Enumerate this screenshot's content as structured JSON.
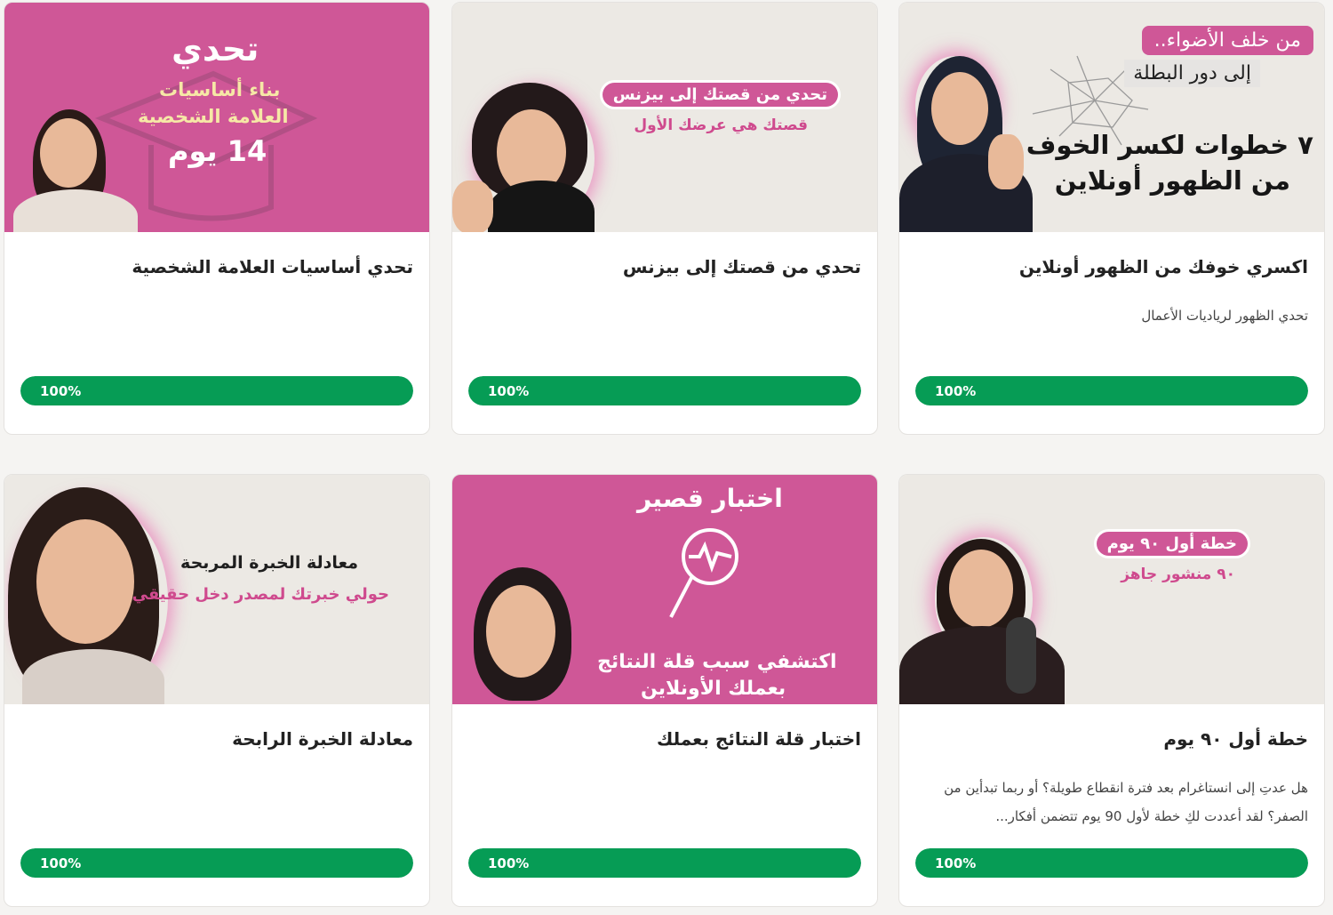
{
  "colors": {
    "accent_pink": "#cf5797",
    "progress_green": "#069c55",
    "card_bg": "#ffffff",
    "page_bg": "#f5f4f2"
  },
  "cards": [
    {
      "title": "اكسري خوفك من الظهور أونلاين",
      "description": "تحدي الظهور لرياديات الأعمال",
      "progress": 1.0,
      "progress_label": "100%",
      "thumb": {
        "top_pill": "من خلف الأضواء..",
        "sub": "إلى دور البطلة",
        "headline_1": "٧ خطوات لكسر الخوف",
        "headline_2": "من الظهور أونلاين"
      }
    },
    {
      "title": "تحدي من قصتك إلى بيزنس",
      "description": "",
      "progress": 1.0,
      "progress_label": "100%",
      "thumb": {
        "pill": "تحدي من قصتك إلى بيزنس",
        "sub": "قصتك هي عرضك الأول"
      }
    },
    {
      "title": "تحدي أساسيات العلامة الشخصية",
      "description": "",
      "progress": 1.0,
      "progress_label": "100%",
      "thumb": {
        "headline": "تحدي",
        "line_1": "بناء أساسيات",
        "line_2": "العلامة الشخصية",
        "days": "14 يوم"
      }
    },
    {
      "title": "خطة أول ٩٠ يوم",
      "description": "هل عدتِ إلى انستاغرام بعد فترة انقطاع طويلة؟ أو ربما تبدأين من الصفر؟ لقد أعددت لكِ خطة لأول 90 يوم تتضمن أفكار...",
      "progress": 1.0,
      "progress_label": "100%",
      "thumb": {
        "pill": "خطة أول ٩٠ يوم",
        "sub": "٩٠ منشور جاهز"
      }
    },
    {
      "title": "اختبار قلة النتائج بعملك",
      "description": "",
      "progress": 1.0,
      "progress_label": "100%",
      "thumb": {
        "headline": "اختبار قصير",
        "line_1": "اكتشفي سبب قلة النتائج",
        "line_2": "بعملك الأونلاين"
      }
    },
    {
      "title": "معادلة الخبرة الرابحة",
      "description": "",
      "progress": 1.0,
      "progress_label": "100%",
      "thumb": {
        "headline": "معادلة الخبرة المربحة",
        "sub": "حولي خبرتك لمصدر دخل حقيقي"
      }
    }
  ]
}
